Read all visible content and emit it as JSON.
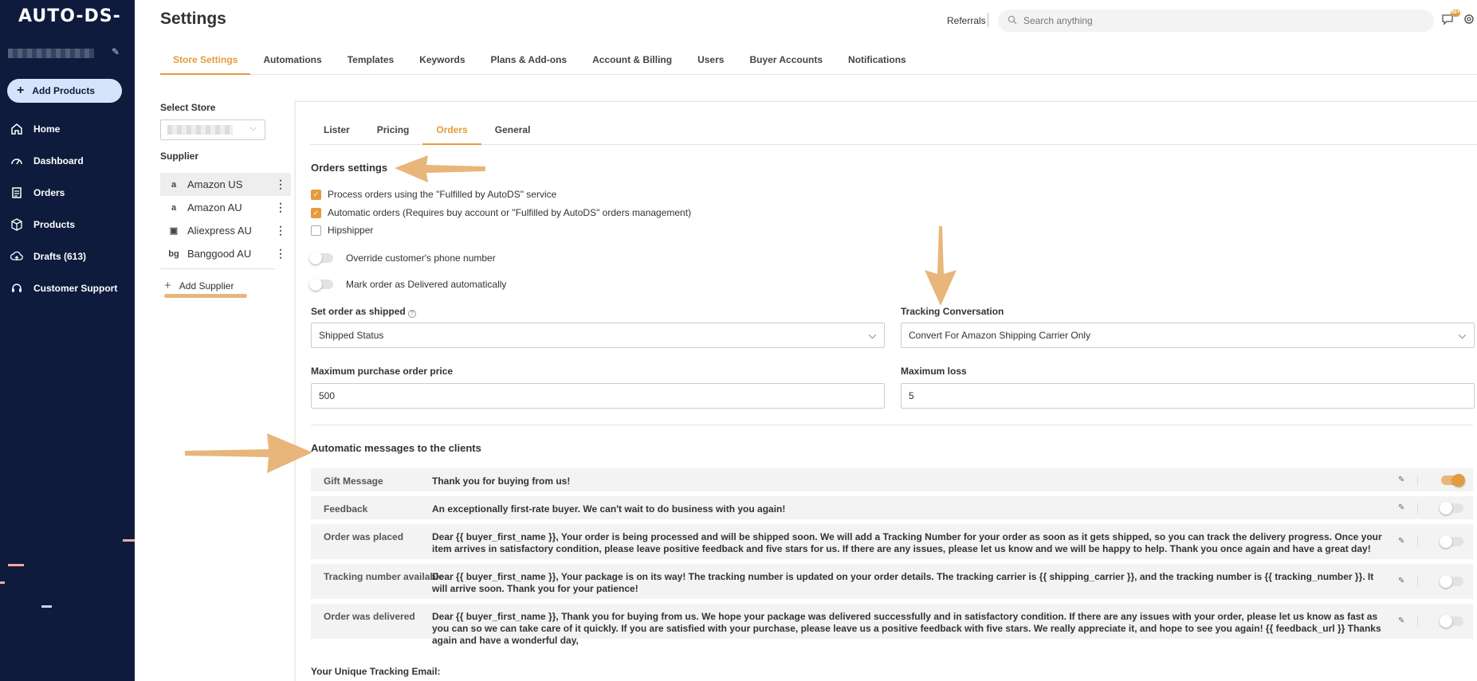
{
  "sidebar": {
    "logo": "AUTO-DS-",
    "add_products": "Add Products",
    "items": [
      {
        "label": "Home",
        "icon": "home-icon"
      },
      {
        "label": "Dashboard",
        "icon": "dashboard-icon"
      },
      {
        "label": "Orders",
        "icon": "orders-icon"
      },
      {
        "label": "Products",
        "icon": "products-icon"
      },
      {
        "label": "Drafts (613)",
        "icon": "drafts-icon"
      },
      {
        "label": "Customer Support",
        "icon": "support-icon"
      }
    ]
  },
  "header": {
    "title": "Settings",
    "referrals": "Referrals",
    "search_placeholder": "Search anything",
    "badge": "99+"
  },
  "top_tabs": [
    "Store Settings",
    "Automations",
    "Templates",
    "Keywords",
    "Plans & Add-ons",
    "Account & Billing",
    "Users",
    "Buyer Accounts",
    "Notifications"
  ],
  "store": {
    "select_label": "Select Store",
    "supplier_label": "Supplier",
    "suppliers": [
      {
        "name": "Amazon US",
        "icon": "a"
      },
      {
        "name": "Amazon AU",
        "icon": "a"
      },
      {
        "name": "Aliexpress AU",
        "icon": "▣"
      },
      {
        "name": "Banggood AU",
        "icon": "bg"
      }
    ],
    "add_supplier": "Add Supplier"
  },
  "inner_tabs": [
    "Lister",
    "Pricing",
    "Orders",
    "General"
  ],
  "orders": {
    "title": "Orders settings",
    "checks": [
      {
        "label": "Process orders using the \"Fulfilled by AutoDS\" service",
        "checked": true
      },
      {
        "label": "Automatic orders (Requires buy account or \"Fulfilled by AutoDS\" orders management)",
        "checked": true
      },
      {
        "label": "Hipshipper",
        "checked": false
      }
    ],
    "toggles": [
      {
        "label": "Override customer's phone number",
        "on": false
      },
      {
        "label": "Mark order as Delivered automatically",
        "on": false
      }
    ],
    "set_shipped_label": "Set order as shipped",
    "set_shipped_value": "Shipped Status",
    "tracking_label": "Tracking Conversation",
    "tracking_value": "Convert For Amazon Shipping Carrier Only",
    "max_price_label": "Maximum purchase order price",
    "max_price_value": "500",
    "max_loss_label": "Maximum loss",
    "max_loss_value": "5"
  },
  "messages": {
    "title": "Automatic messages to the clients",
    "rows": [
      {
        "name": "Gift Message",
        "text": "Thank you for buying from us!",
        "on": true
      },
      {
        "name": "Feedback",
        "text": "An exceptionally first-rate buyer. We can't wait to do business with you again!",
        "on": false
      },
      {
        "name": "Order was placed",
        "text": "Dear {{ buyer_first_name }}, Your order is being processed and will be shipped soon. We will add a Tracking Number for your order as soon as it gets shipped, so you can track the delivery progress. Once your item arrives in satisfactory condition, please leave positive feedback and five stars for us. If there are any issues, please let us know and we will be happy to help. Thank you once again and have a great day!",
        "on": false
      },
      {
        "name": "Tracking number available",
        "text": "Dear {{ buyer_first_name }}, Your package is on its way! The tracking number is updated on your order details. The tracking carrier is {{ shipping_carrier }}, and the tracking number is {{ tracking_number }}. It will arrive soon. Thank you for your patience!",
        "on": false
      },
      {
        "name": "Order was delivered",
        "text": "Dear {{ buyer_first_name }}, Thank you for buying from us. We hope your package was delivered successfully and in satisfactory condition. If there are any issues with your order, please let us know as fast as you can so we can take care of it quickly. If you are satisfied with your purchase, please leave us a positive feedback with five stars. We really appreciate it, and hope to see you again! {{ feedback_url }} Thanks again and have a wonderful day,",
        "on": false
      }
    ],
    "tracking_email_label": "Your Unique Tracking Email:"
  },
  "colors": {
    "accent": "#e49b3d",
    "sidebar": "#0f1b3d",
    "arrow": "#e8b67a"
  }
}
